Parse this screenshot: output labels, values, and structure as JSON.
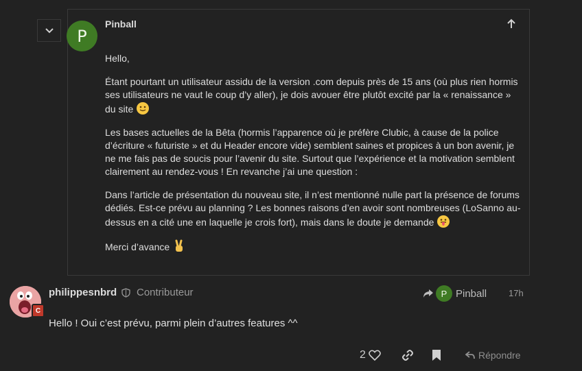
{
  "quote": {
    "username": "Pinball",
    "avatar_letter": "P",
    "avatar_color": "#3f7b24",
    "paragraphs": {
      "p1": "Hello,",
      "p2": "Étant pourtant un utilisateur assidu de la version .com depuis près de 15 ans (où plus rien hormis ses utilisateurs ne vaut le coup d’y aller), je dois avouer être plutôt excité par la « renaissance » du site",
      "p3": "Les bases actuelles de la Bêta (hormis l’apparence où je préfère Clubic, à cause de la police d’écriture « futuriste » et du Header encore vide) semblent saines et propices à un bon avenir, je ne me fais pas de soucis pour l’avenir du site. Surtout que l’expérience et la motivation semblent clairement au rendez-vous ! En revanche j’ai une question :",
      "p4": "Dans l’article de présentation du nouveau site, il n’est mentionné nulle part la présence de forums dédiés. Est-ce prévu au planning ? Les bonnes raisons d’en avoir sont nombreuses (LoSanno au-dessus en a cité une en laquelle je crois fort), mais dans le doute je demande",
      "p5": "Merci d’avance"
    },
    "emojis": [
      "slightly-smiling-face",
      "tongue-out-face",
      "victory-hand"
    ]
  },
  "post": {
    "username": "philippesnbrd",
    "user_title": "Contributeur",
    "flair_letter": "C",
    "flair_color": "#c0392b",
    "reply_to": {
      "name": "Pinball",
      "avatar_letter": "P"
    },
    "date": "17h",
    "text": "Hello ! Oui c’est prévu, parmi plein d’autres features ^^",
    "likes": "2",
    "reply_label": "Répondre"
  }
}
